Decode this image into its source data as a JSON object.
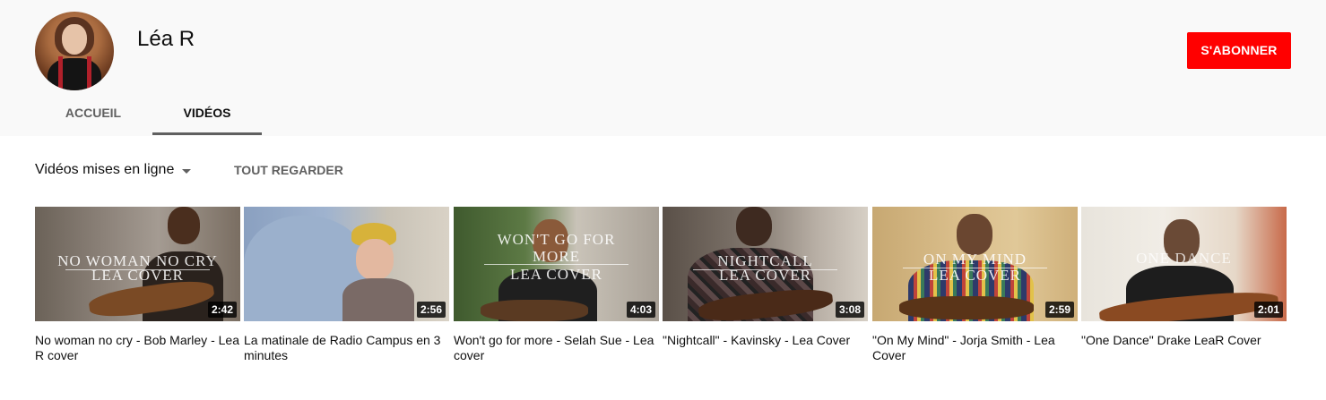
{
  "channel": {
    "name": "Léa R",
    "subscribe_label": "S'ABONNER"
  },
  "tabs": [
    {
      "label": "ACCUEIL"
    },
    {
      "label": "VIDÉOS"
    }
  ],
  "toolbar": {
    "sort_label": "Vidéos mises en ligne",
    "play_all_label": "TOUT REGARDER"
  },
  "videos": [
    {
      "title": "No woman no cry - Bob Marley - Lea R cover",
      "duration": "2:42",
      "overlay": [
        "NO WOMAN NO CRY",
        "LEA COVER"
      ]
    },
    {
      "title": "La matinale de Radio Campus en 3 minutes",
      "duration": "2:56",
      "overlay": []
    },
    {
      "title": "Won't go for more - Selah Sue - Lea cover",
      "duration": "4:03",
      "overlay": [
        "WON'T GO FOR",
        "MORE",
        "LEA COVER"
      ]
    },
    {
      "title": "\"Nightcall\" - Kavinsky - Lea Cover",
      "duration": "3:08",
      "overlay": [
        "NIGHTCALL",
        "LEA COVER"
      ]
    },
    {
      "title": "\"On My Mind\" - Jorja Smith - Lea Cover",
      "duration": "2:59",
      "overlay": [
        "ON MY MIND",
        "LEA COVER"
      ]
    },
    {
      "title": "\"One Dance\" Drake LeaR Cover",
      "duration": "2:01",
      "overlay": [
        "ONE DANCE"
      ]
    }
  ],
  "colors": {
    "accent": "#ff0000",
    "header_bg": "#f9f9f9"
  }
}
